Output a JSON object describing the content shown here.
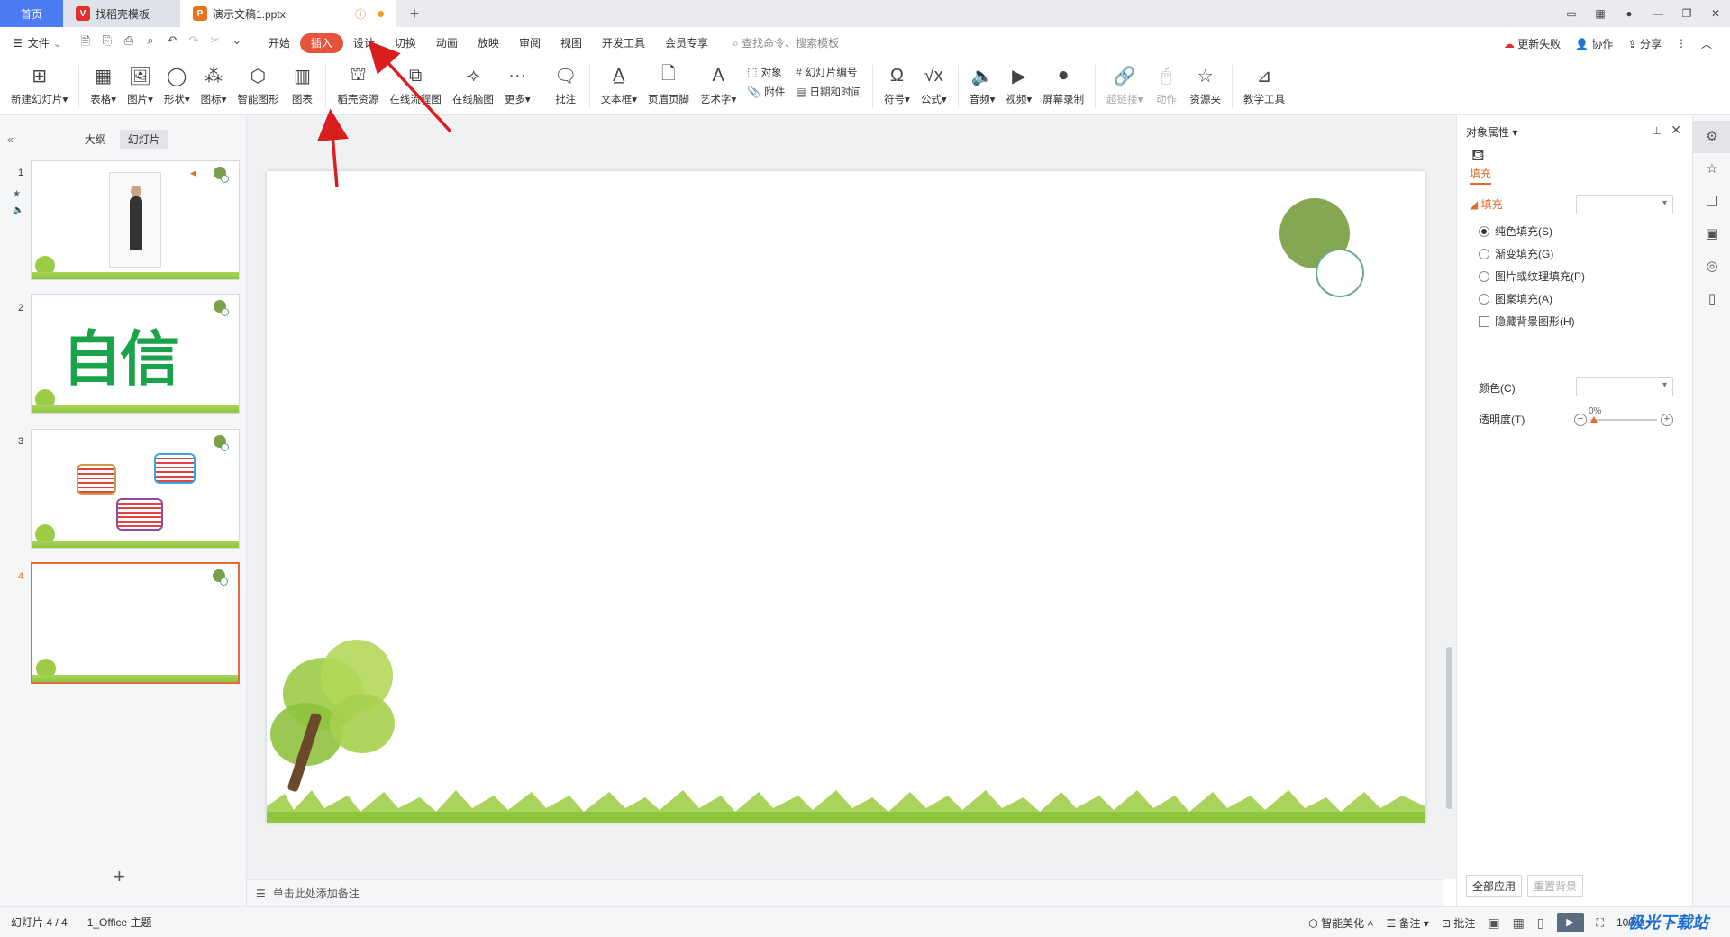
{
  "tabs": [
    {
      "label": "首页"
    },
    {
      "label": "找稻壳模板",
      "icon": "daoke-logo-icon"
    },
    {
      "label": "演示文稿1.pptx",
      "icon": "presentation-file-icon"
    }
  ],
  "window_controls": [
    "1",
    "grid",
    "avatar",
    "minimize",
    "restore",
    "close"
  ],
  "menu": {
    "file": "文件",
    "items": [
      "开始",
      "插入",
      "设计",
      "切换",
      "动画",
      "放映",
      "审阅",
      "视图",
      "开发工具",
      "会员专享"
    ],
    "active": "插入",
    "search_placeholder": "查找命令、搜索模板",
    "right": [
      "更新失败",
      "协作",
      "分享"
    ]
  },
  "ribbon": {
    "new_slide": "新建幻灯片",
    "table": "表格",
    "picture": "图片",
    "shape": "形状",
    "icon": "图标",
    "smart_graphic": "智能图形",
    "chart": "图表",
    "daoke_resource": "稻壳资源",
    "online_flowchart": "在线流程图",
    "online_mindmap": "在线脑图",
    "more": "更多",
    "comment": "批注",
    "textbox": "文本框",
    "header_footer": "页眉页脚",
    "wordart": "艺术字",
    "object": "对象",
    "attachment": "附件",
    "slide_number": "幻灯片编号",
    "date_time": "日期和时间",
    "symbol": "符号",
    "formula": "公式",
    "audio": "音频",
    "video": "视频",
    "screen_record": "屏幕录制",
    "hyperlink": "超链接",
    "action": "动作",
    "resource_folder": "资源夹",
    "teaching_tools": "教学工具"
  },
  "left_panel": {
    "tab_outline": "大纲",
    "tab_slides": "幻灯片",
    "slides": [
      {
        "num": "1"
      },
      {
        "num": "2",
        "text": "自信"
      },
      {
        "num": "3"
      },
      {
        "num": "4"
      }
    ],
    "selected": "4"
  },
  "notes_placeholder": "单击此处添加备注",
  "right_panel": {
    "title": "对象属性",
    "fill_tab": "填充",
    "section": "填充",
    "options": [
      "纯色填充(S)",
      "渐变填充(G)",
      "图片或纹理填充(P)",
      "图案填充(A)"
    ],
    "selected_option": "纯色填充(S)",
    "hide_bg": "隐藏背景图形(H)",
    "color_label": "颜色(C)",
    "transparency_label": "透明度(T)",
    "transparency_value": "0%",
    "apply_all": "全部应用",
    "reset_bg": "重置背景"
  },
  "status": {
    "slide_info": "幻灯片 4 / 4",
    "theme": "1_Office 主题",
    "smart_beautify": "智能美化",
    "notes": "备注",
    "comments": "批注",
    "zoom": "100%"
  },
  "watermark": "极光下载站",
  "colors": {
    "accent": "#e5533c",
    "home_tab": "#4d7bf3",
    "circle_fill": "#85a752",
    "grass": "#8cc63f"
  }
}
